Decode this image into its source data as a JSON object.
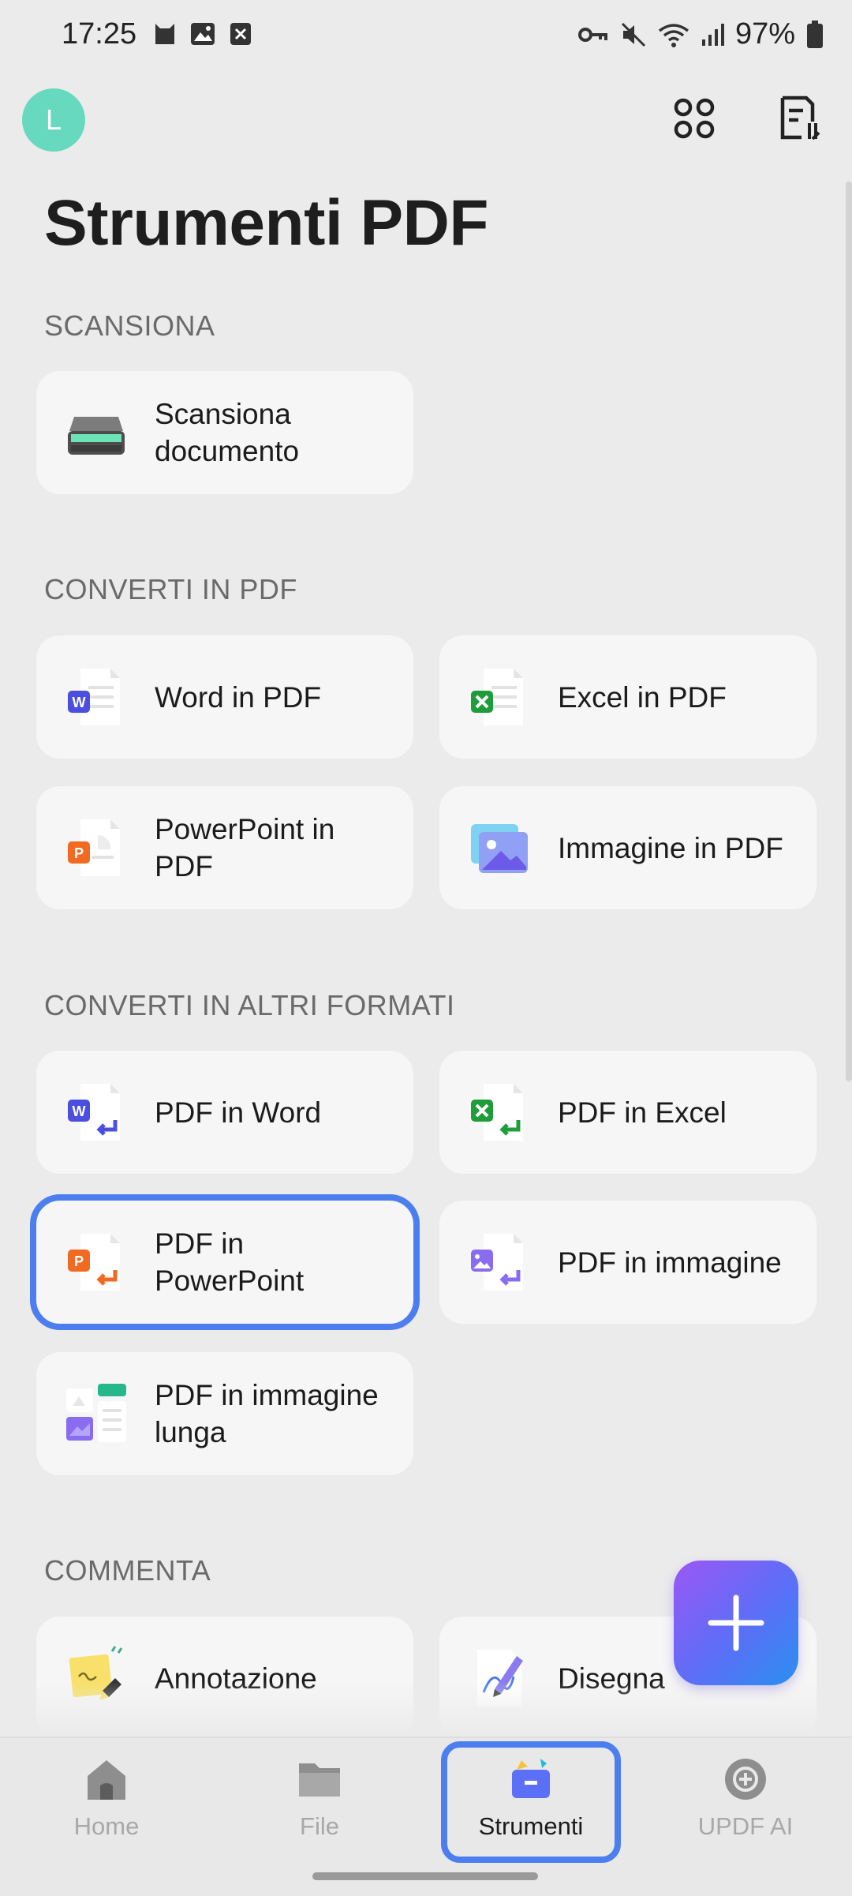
{
  "status_bar": {
    "time": "17:25",
    "battery": "97%"
  },
  "header": {
    "avatar_letter": "L",
    "title": "Strumenti PDF"
  },
  "sections": {
    "scan": {
      "label": "SCANSIONA",
      "items": [
        {
          "label": "Scansiona documento"
        }
      ]
    },
    "to_pdf": {
      "label": "CONVERTI IN PDF",
      "items": [
        {
          "label": "Word in PDF"
        },
        {
          "label": "Excel in PDF"
        },
        {
          "label": "PowerPoint in PDF"
        },
        {
          "label": "Immagine in PDF"
        }
      ]
    },
    "from_pdf": {
      "label": "CONVERTI IN ALTRI FORMATI",
      "items": [
        {
          "label": "PDF in Word"
        },
        {
          "label": "PDF in Excel"
        },
        {
          "label": "PDF in PowerPoint"
        },
        {
          "label": "PDF in immagine"
        },
        {
          "label": "PDF in immagine lunga"
        }
      ]
    },
    "comment": {
      "label": "COMMENTA",
      "items": [
        {
          "label": "Annotazione"
        },
        {
          "label": "Disegna"
        }
      ]
    }
  },
  "bottom_nav": {
    "items": [
      {
        "label": "Home"
      },
      {
        "label": "File"
      },
      {
        "label": "Strumenti",
        "active": true
      },
      {
        "label": "UPDF AI"
      }
    ]
  },
  "colors": {
    "accent": "#4c7ef0",
    "avatar": "#66d9bf",
    "word": "#4b4fe0",
    "excel": "#1f9d3a",
    "powerpoint": "#f06a21"
  }
}
